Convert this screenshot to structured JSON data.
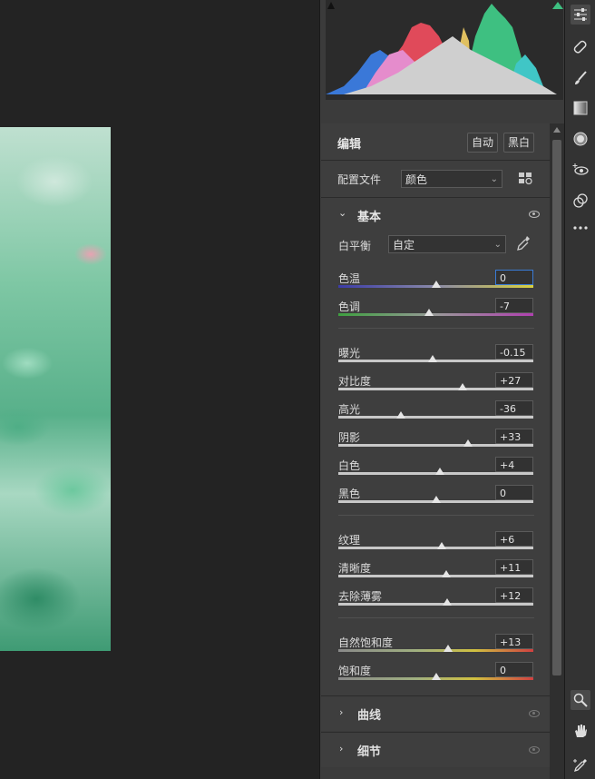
{
  "editor": {
    "title": "编辑",
    "auto_label": "自动",
    "bw_label": "黑白"
  },
  "profile": {
    "label": "配置文件",
    "value": "颜色"
  },
  "basic": {
    "title": "基本",
    "white_balance_label": "白平衡",
    "white_balance_value": "自定",
    "sliders": [
      {
        "label": "色温",
        "value": "0",
        "position": 0.5,
        "track": "temp"
      },
      {
        "label": "色调",
        "value": "-7",
        "position": 0.465,
        "track": "tint"
      },
      {
        "label": "曝光",
        "value": "-0.15",
        "position": 0.485,
        "track": "gray"
      },
      {
        "label": "对比度",
        "value": "+27",
        "position": 0.635,
        "track": "gray"
      },
      {
        "label": "高光",
        "value": "-36",
        "position": 0.32,
        "track": "gray"
      },
      {
        "label": "阴影",
        "value": "+33",
        "position": 0.665,
        "track": "gray"
      },
      {
        "label": "白色",
        "value": "+4",
        "position": 0.52,
        "track": "gray"
      },
      {
        "label": "黑色",
        "value": "0",
        "position": 0.5,
        "track": "gray"
      },
      {
        "label": "纹理",
        "value": "+6",
        "position": 0.53,
        "track": "gray"
      },
      {
        "label": "清晰度",
        "value": "+11",
        "position": 0.555,
        "track": "gray"
      },
      {
        "label": "去除薄雾",
        "value": "+12",
        "position": 0.56,
        "track": "gray"
      },
      {
        "label": "自然饱和度",
        "value": "+13",
        "position": 0.565,
        "track": "vibrance"
      },
      {
        "label": "饱和度",
        "value": "0",
        "position": 0.5,
        "track": "saturation"
      }
    ]
  },
  "sections": {
    "curves": "曲线",
    "detail": "细节"
  },
  "toolbar": {
    "tools": [
      "edit-sliders-icon",
      "healing-icon",
      "brush-icon",
      "gradient-icon",
      "radial-icon",
      "redeye-icon",
      "presets-icon",
      "more-icon",
      "zoom-icon",
      "hand-icon",
      "sampler-icon"
    ]
  }
}
